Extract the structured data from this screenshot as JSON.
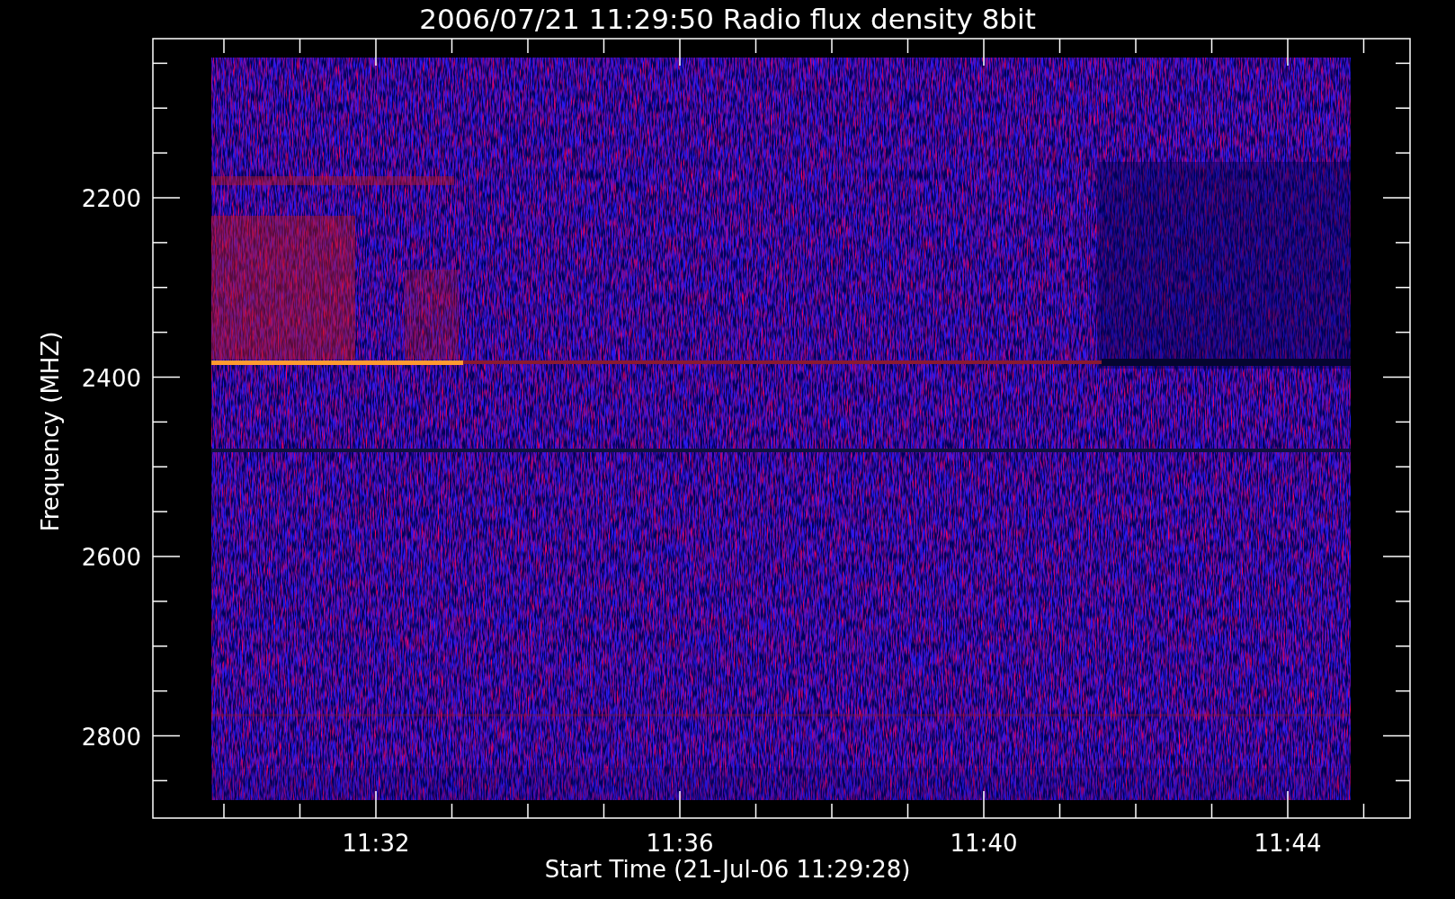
{
  "title": "2006/07/21 11:29:50 Radio flux density 8bit",
  "y_axis": {
    "label": "Frequency (MHZ)",
    "ticks": [
      "2200",
      "2400",
      "2600",
      "2800"
    ]
  },
  "x_axis": {
    "label": "Start Time (21-Jul-06 11:29:28)",
    "ticks": [
      "11:32",
      "11:36",
      "11:40",
      "11:44"
    ]
  }
}
